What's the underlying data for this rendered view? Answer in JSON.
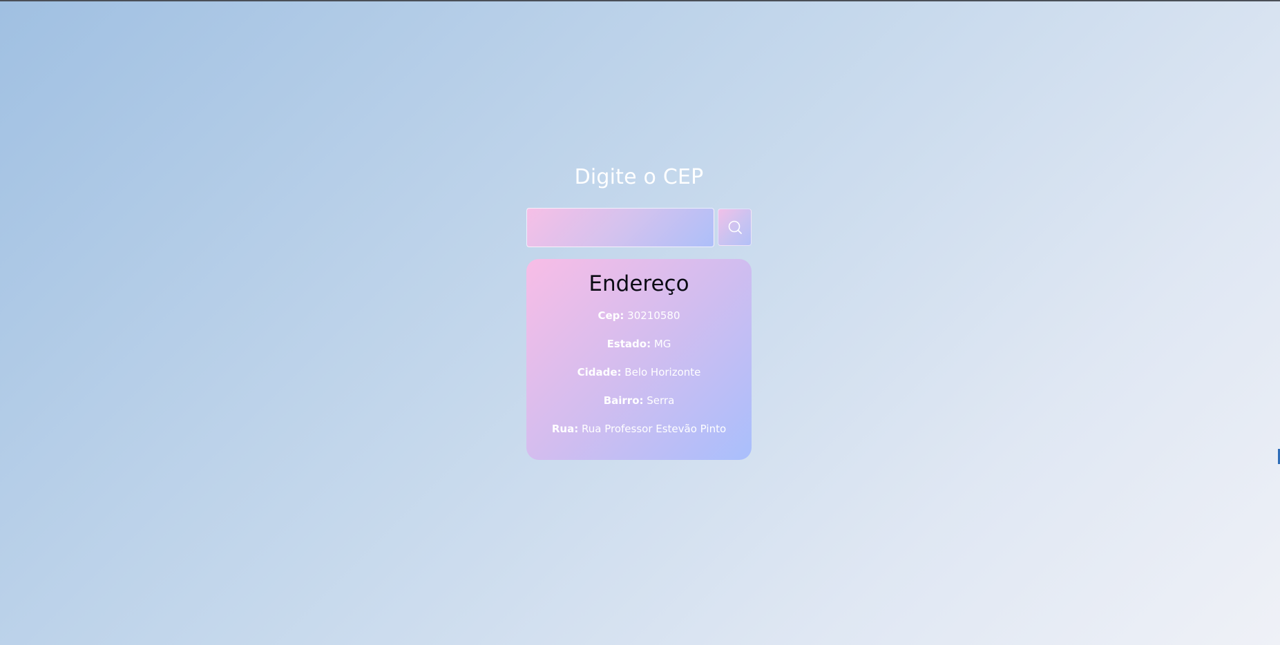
{
  "page": {
    "heading": "Digite o CEP"
  },
  "search": {
    "input_value": "",
    "placeholder": "",
    "button_icon": "search-icon"
  },
  "address": {
    "title": "Endereço",
    "fields": [
      {
        "label": "Cep:",
        "value": "30210580"
      },
      {
        "label": "Estado:",
        "value": "MG"
      },
      {
        "label": "Cidade:",
        "value": "Belo Horizonte"
      },
      {
        "label": "Bairro:",
        "value": "Serra"
      },
      {
        "label": "Rua:",
        "value": "Rua Professor Estevão Pinto"
      }
    ]
  },
  "colors": {
    "background_start": "#a0c0e2",
    "background_end": "#eff1f7",
    "card_start": "#f8bde6",
    "card_end": "#a9bffc",
    "heading_text": "#ffffff",
    "card_title_text": "#0b0b14"
  }
}
